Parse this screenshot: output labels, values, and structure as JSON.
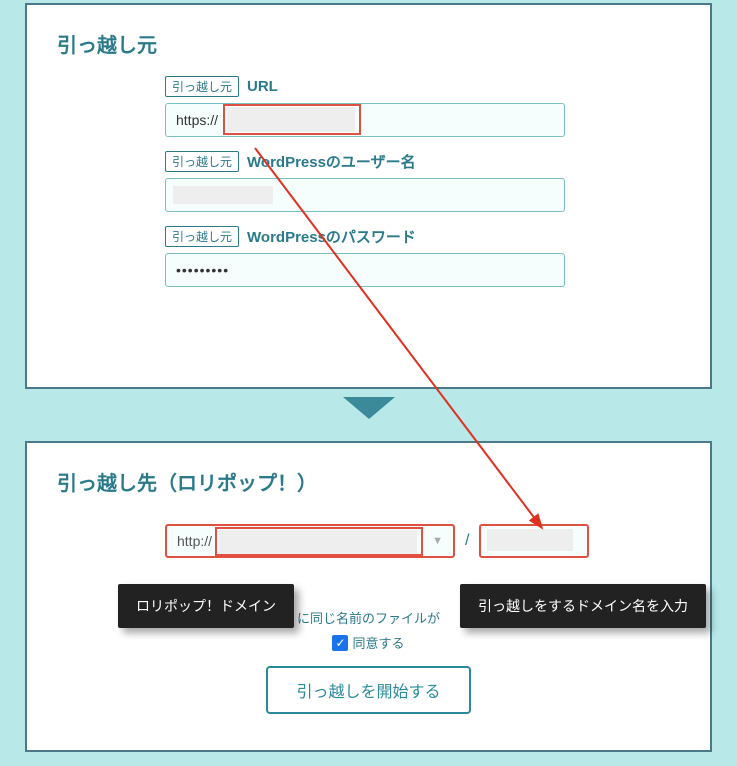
{
  "source": {
    "title": "引っ越し元",
    "tag": "引っ越し元",
    "url_label": "URL",
    "url_value": "https://",
    "user_label": "WordPressのユーザー名",
    "user_value": "",
    "pass_label": "WordPressのパスワード",
    "pass_value": "•••••••••"
  },
  "dest": {
    "title": "引っ越し先（ロリポップ！）",
    "domain_value": "http://",
    "slash": "/",
    "consent_line": "に同じ名前のファイルが",
    "consent_label": "同意する",
    "start_label": "引っ越しを開始する"
  },
  "callouts": {
    "domain_hint": "ロリポップ！ドメイン",
    "subdir_hint": "引っ越しをするドメイン名を入力"
  }
}
